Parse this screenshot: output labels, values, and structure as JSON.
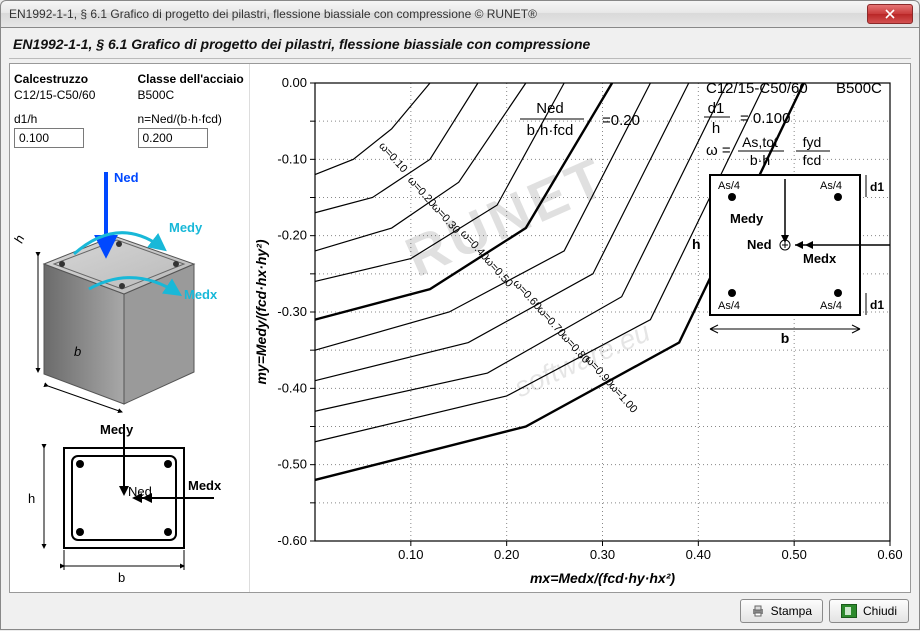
{
  "window": {
    "title": "EN1992-1-1, § 6.1  Grafico di progetto dei pilastri, flessione biassiale con compressione © RUNET®"
  },
  "panel": {
    "title": "EN1992-1-1, § 6.1  Grafico di progetto dei pilastri, flessione biassiale con compressione"
  },
  "inputs": {
    "concrete_label": "Calcestruzzo",
    "concrete_value": "C12/15-C50/60",
    "steel_label": "Classe dell'acciaio",
    "steel_value": "B500C",
    "d1h_label": "d1/h",
    "d1h_value": "0.100",
    "n_label": "n=Ned/(b·h·fcd)",
    "n_value": "0.200"
  },
  "diagram3d": {
    "Ned": "Ned",
    "Medy": "Medy",
    "Medx": "Medx",
    "h": "h",
    "b": "b"
  },
  "plan": {
    "Medy": "Medy",
    "Medx": "Medx",
    "Ned": "Ned",
    "h": "h",
    "b": "b"
  },
  "chart_annotations": {
    "top_left_frac_num": "Ned",
    "top_left_frac_den": "b·h·fcd",
    "top_left_eq": "=0.20",
    "top_right_mat1": "C12/15-C50/60",
    "top_right_mat2": "B500C",
    "d1h_label": "d1",
    "d1h_den": "h",
    "d1h_val": "= 0.100",
    "omega_eq_num": "As,tot",
    "omega_eq_den": "b·h",
    "omega_eq_num2": "fyd",
    "omega_eq_den2": "fcd",
    "omega_sym": "ω =",
    "section_As4": "As/4",
    "section_d1": "d1",
    "section_h": "h",
    "section_b": "b",
    "section_Medy": "Medy",
    "section_Ned": "Ned",
    "section_Medx": "Medx"
  },
  "chart_data": {
    "type": "line",
    "title": "",
    "xlabel": "mx=Medx/(fcd·hy·hx²)",
    "ylabel": "my=Medy/(fcd·hx·hy²)",
    "xlim": [
      0,
      0.6
    ],
    "ylim": [
      -0.6,
      0.0
    ],
    "xticks": [
      0.1,
      0.2,
      0.3,
      0.4,
      0.5,
      0.6
    ],
    "yticks": [
      -0.6,
      -0.55,
      -0.5,
      -0.45,
      -0.4,
      -0.35,
      -0.3,
      -0.25,
      -0.2,
      -0.15,
      -0.1,
      -0.05,
      0.0
    ],
    "ytick_labels": [
      "-0.60",
      "",
      "-0.50",
      "",
      "-0.40",
      "",
      "-0.30",
      "",
      "-0.20",
      "",
      "-0.10",
      "",
      "0.00"
    ],
    "series": [
      {
        "name": "ω=0.10",
        "x": [
          0.0,
          0.04,
          0.08,
          0.12
        ],
        "y": [
          -0.12,
          -0.1,
          -0.06,
          0.0
        ]
      },
      {
        "name": "ω=0.20",
        "x": [
          0.0,
          0.06,
          0.12,
          0.17
        ],
        "y": [
          -0.17,
          -0.15,
          -0.1,
          0.0
        ]
      },
      {
        "name": "ω=0.30",
        "x": [
          0.0,
          0.08,
          0.15,
          0.22
        ],
        "y": [
          -0.22,
          -0.19,
          -0.13,
          0.0
        ]
      },
      {
        "name": "ω=0.40",
        "x": [
          0.0,
          0.1,
          0.19,
          0.26
        ],
        "y": [
          -0.26,
          -0.23,
          -0.16,
          0.0
        ]
      },
      {
        "name": "ω=0.50",
        "x": [
          0.0,
          0.12,
          0.22,
          0.31
        ],
        "y": [
          -0.31,
          -0.27,
          -0.19,
          0.0
        ],
        "thick": true
      },
      {
        "name": "ω=0.60",
        "x": [
          0.0,
          0.14,
          0.26,
          0.35
        ],
        "y": [
          -0.35,
          -0.3,
          -0.22,
          0.0
        ]
      },
      {
        "name": "ω=0.70",
        "x": [
          0.0,
          0.16,
          0.29,
          0.39
        ],
        "y": [
          -0.39,
          -0.34,
          -0.25,
          0.0
        ]
      },
      {
        "name": "ω=0.80",
        "x": [
          0.0,
          0.18,
          0.32,
          0.43
        ],
        "y": [
          -0.43,
          -0.38,
          -0.28,
          0.0
        ]
      },
      {
        "name": "ω=0.90",
        "x": [
          0.0,
          0.2,
          0.35,
          0.47
        ],
        "y": [
          -0.47,
          -0.41,
          -0.31,
          0.0
        ]
      },
      {
        "name": "ω=1.00",
        "x": [
          0.0,
          0.22,
          0.38,
          0.51
        ],
        "y": [
          -0.52,
          -0.45,
          -0.34,
          0.0
        ],
        "thick": true
      }
    ]
  },
  "watermark": {
    "main": "RUNET",
    "sub": "software.eu"
  },
  "footer": {
    "print": "Stampa",
    "close": "Chiudi"
  }
}
